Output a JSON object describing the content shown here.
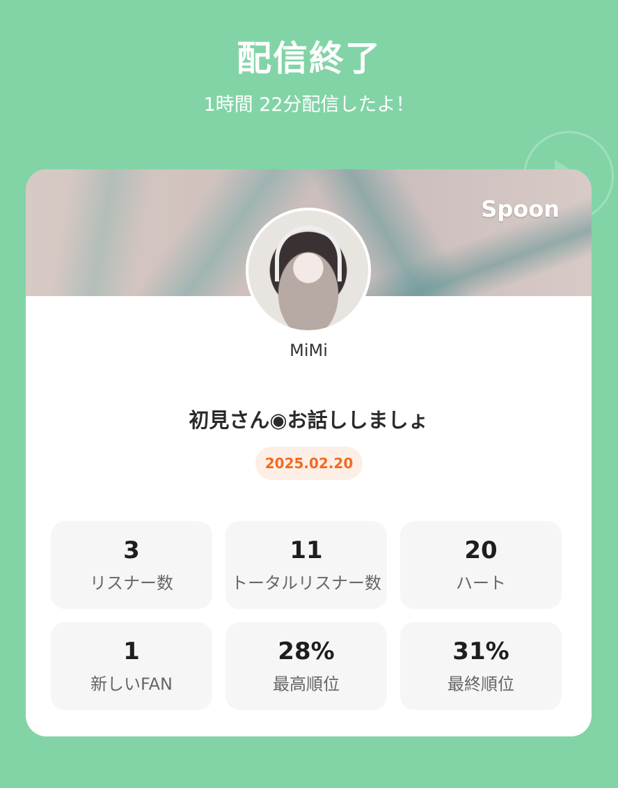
{
  "header": {
    "title": "配信終了",
    "subtitle": "1時間 22分配信したよ！"
  },
  "card": {
    "brand": "Spoon",
    "username": "MiMi",
    "live_title": "初見さん◉お話ししましょ",
    "date": "2025.02.20",
    "stats": [
      {
        "value": "3",
        "label": "リスナー数"
      },
      {
        "value": "11",
        "label": "トータルリスナー数"
      },
      {
        "value": "20",
        "label": "ハート"
      },
      {
        "value": "1",
        "label": "新しいFAN"
      },
      {
        "value": "28%",
        "label": "最高順位"
      },
      {
        "value": "31%",
        "label": "最終順位"
      }
    ]
  },
  "colors": {
    "background": "#82d4a6",
    "date_badge_text": "#f26b21",
    "date_badge_bg": "#fdeee6"
  }
}
